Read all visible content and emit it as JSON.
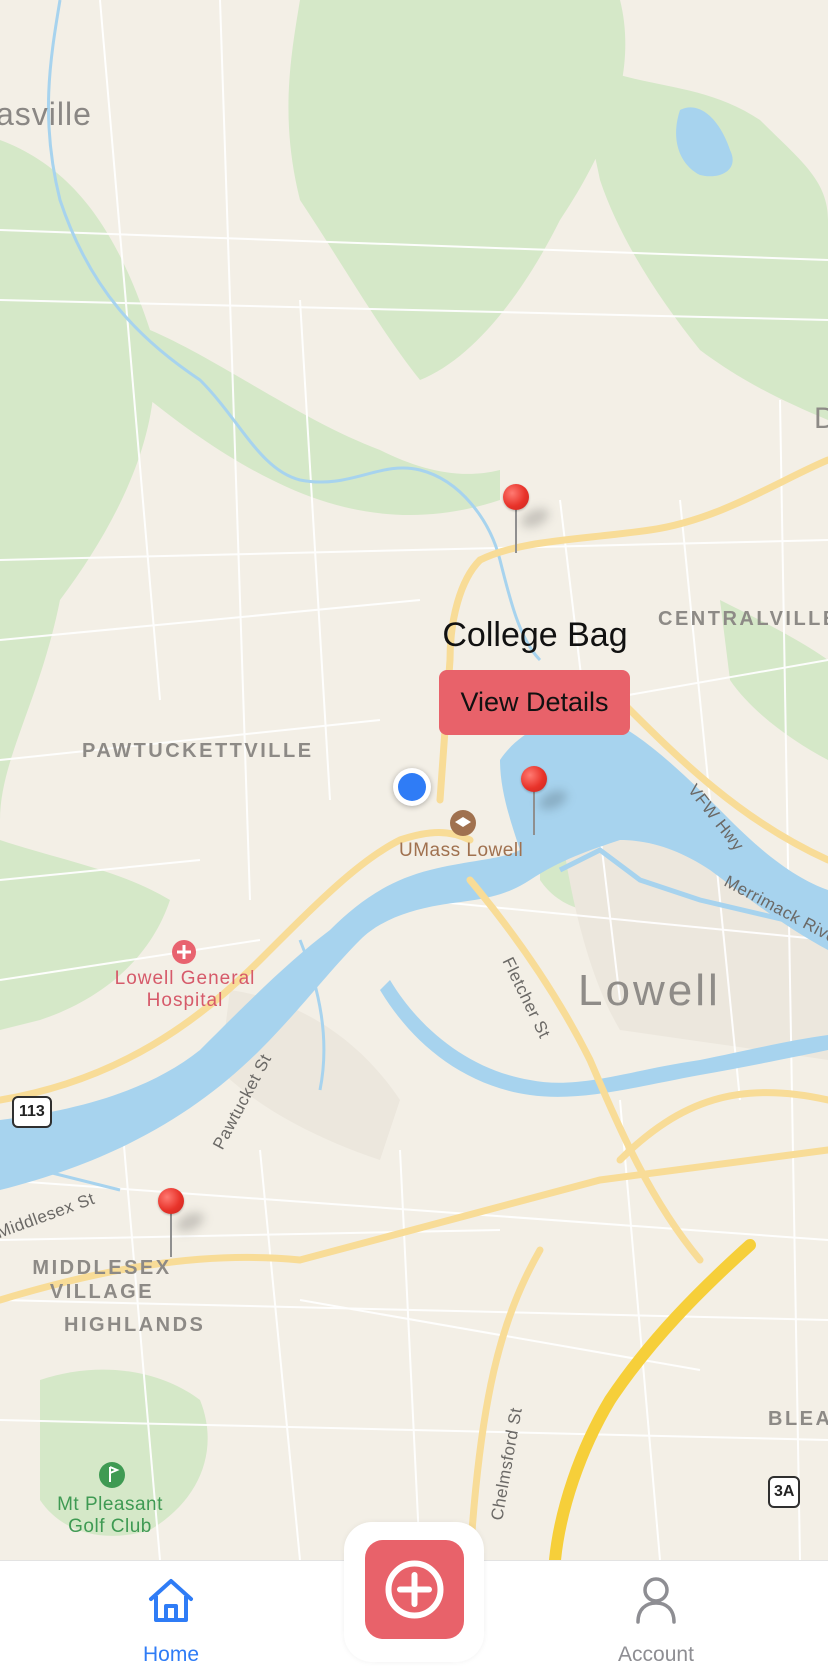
{
  "map": {
    "labels": {
      "top_left_town": "asville",
      "pawtucketville": "PAWTUCKETTVILLE",
      "centralville": "CENTRALVILLE",
      "right_edge_d": "D",
      "umass": "UMass Lowell",
      "hospital": "Lowell General Hospital",
      "city": "Lowell",
      "middlesex_village": "MIDDLESEX VILLAGE",
      "highlands": "HIGHLANDS",
      "golf": "Mt Pleasant Golf Club",
      "blea": "BLEA",
      "vfw": "VFW Hwy",
      "merrimack": "Merrimack Rive",
      "fletcher": "Fletcher St",
      "pawtucket_st": "Pawtucket St",
      "middlesex_st": "Middlesex St",
      "chelmsford": "Chelmsford St"
    },
    "shields": {
      "route_113": "113",
      "route_3a": "3A"
    },
    "callout": {
      "title": "College Bag",
      "button_label": "View Details"
    },
    "colors": {
      "water": "#a7d3ee",
      "park": "#d3e8c6",
      "land": "#f3efe6",
      "highway": "#f6cf3a",
      "pin": "#e8332a",
      "user_dot": "#2f7cf6"
    }
  },
  "tabbar": {
    "home_label": "Home",
    "account_label": "Account",
    "add_icon": "plus-icon",
    "accent_color": "#e8626a",
    "active_color": "#2f7cf6"
  }
}
